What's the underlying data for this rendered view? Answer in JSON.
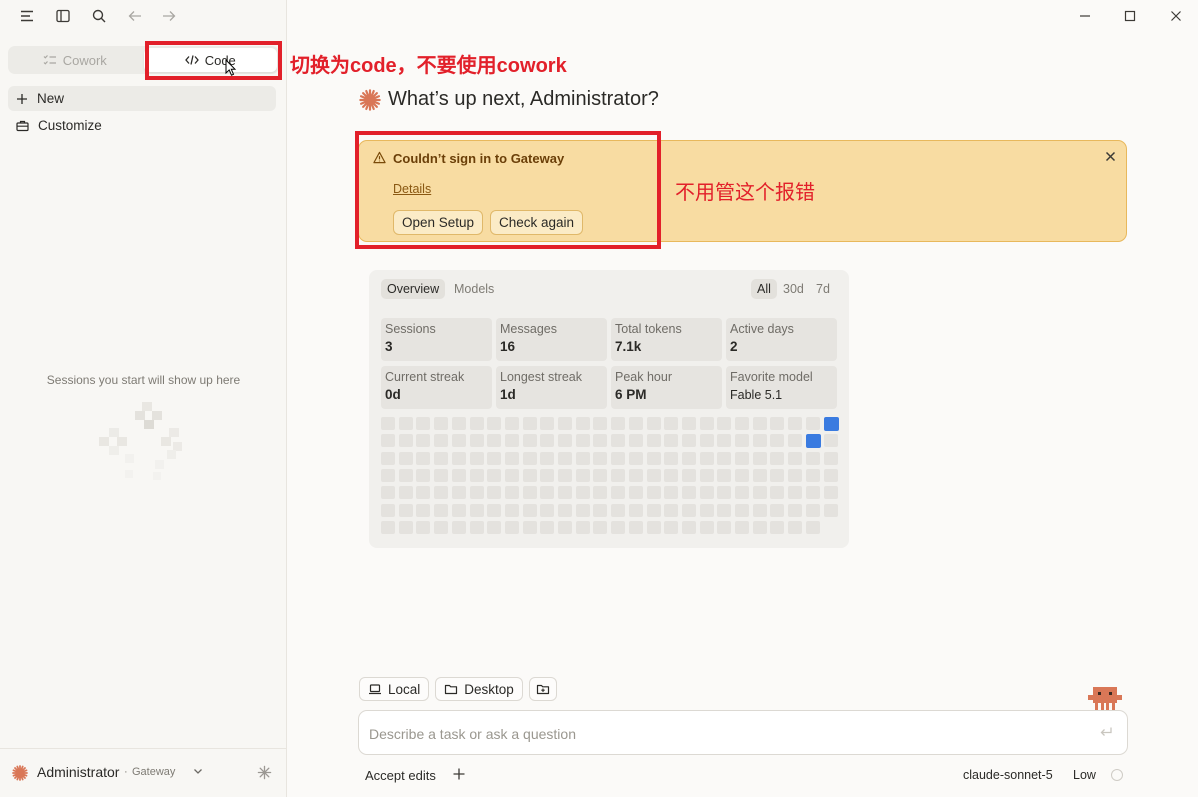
{
  "sidebar": {
    "mode_tabs": [
      {
        "label": "Cowork",
        "icon": "cowork-icon",
        "active": false
      },
      {
        "label": "Code",
        "icon": "code-icon",
        "active": true
      }
    ],
    "items": [
      {
        "label": "New",
        "icon": "plus-icon"
      },
      {
        "label": "Customize",
        "icon": "briefcase-icon"
      }
    ],
    "empty_state": "Sessions you start will show up here",
    "user": {
      "name": "Administrator",
      "separator": "·",
      "org": "Gateway"
    }
  },
  "annotations": {
    "switch_note": "切换为code，不要使用cowork",
    "ignore_note": "不用管这个报错"
  },
  "main": {
    "greeting": "What’s up next, Administrator?",
    "alert": {
      "title": "Couldn’t sign in to Gateway",
      "details_link": "Details",
      "buttons": [
        "Open Setup",
        "Check again"
      ]
    },
    "stats": {
      "tabs": [
        "Overview",
        "Models"
      ],
      "ranges": [
        "All",
        "30d",
        "7d"
      ],
      "cards": [
        {
          "label": "Sessions",
          "value": "3"
        },
        {
          "label": "Messages",
          "value": "16"
        },
        {
          "label": "Total tokens",
          "value": "7.1k"
        },
        {
          "label": "Active days",
          "value": "2"
        },
        {
          "label": "Current streak",
          "value": "0d"
        },
        {
          "label": "Longest streak",
          "value": "1d"
        },
        {
          "label": "Peak hour",
          "value": "6 PM"
        },
        {
          "label": "Favorite model",
          "value": "Fable 5.1"
        }
      ]
    },
    "chips": [
      {
        "label": "Local",
        "icon": "laptop-icon"
      },
      {
        "label": "Desktop",
        "icon": "folder-icon"
      }
    ],
    "prompt": {
      "placeholder": "Describe a task or ask a question"
    },
    "footer": {
      "accept_edits": "Accept edits",
      "model": "claude-sonnet-5",
      "effort": "Low"
    }
  },
  "colors": {
    "accent": "#d97757",
    "annotation_red": "#e2202a",
    "alert_bg": "#f8dca2",
    "heat_active": "#3a7be0"
  }
}
